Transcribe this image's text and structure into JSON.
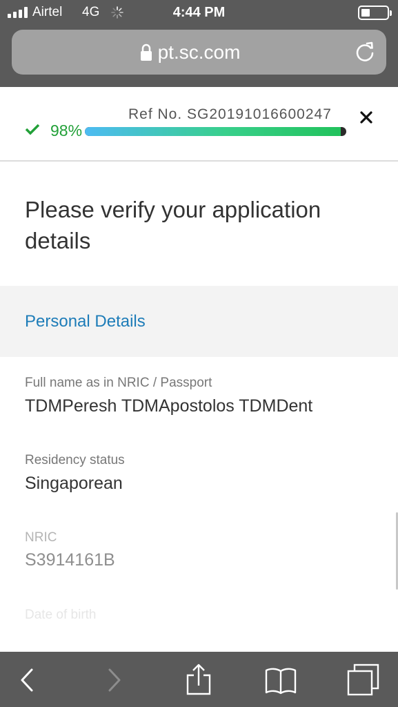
{
  "status_bar": {
    "carrier": "Airtel",
    "network": "4G",
    "time": "4:44 PM"
  },
  "browser": {
    "url": "pt.sc.com"
  },
  "progress": {
    "percent_label": "98%",
    "percent_value": 0.98,
    "ref_no": "Ref No. SG20191016600247"
  },
  "page": {
    "title": "Please verify your application details"
  },
  "section": {
    "title": "Personal Details"
  },
  "fields": [
    {
      "label": "Full name as in NRIC / Passport",
      "value": "TDMPeresh TDMApostolos TDMDent"
    },
    {
      "label": "Residency status",
      "value": "Singaporean"
    },
    {
      "label": "NRIC",
      "value": "S3914161B"
    },
    {
      "label": "Date of birth"
    }
  ],
  "toolbar": {
    "buttons": [
      "back-icon",
      "forward-icon",
      "share-icon",
      "bookmarks-icon",
      "tabs-icon"
    ]
  },
  "colors": {
    "accent_blue": "#1d7cb8",
    "success_green": "#22a038",
    "chrome_gray": "#5a5a5a"
  }
}
